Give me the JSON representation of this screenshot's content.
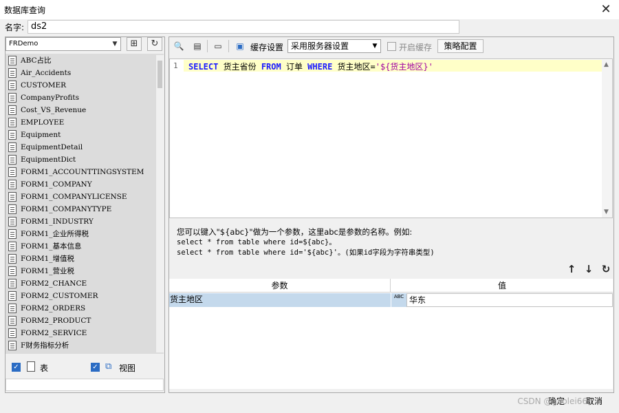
{
  "window": {
    "title": "数据库查询"
  },
  "name": {
    "label": "名字:",
    "value": "ds2"
  },
  "connection": {
    "selected": "FRDemo"
  },
  "tables": [
    "ABC占比",
    "Air_Accidents",
    "CUSTOMER",
    "CompanyProfits",
    "Cost_VS_Revenue",
    "EMPLOYEE",
    "Equipment",
    "EquipmentDetail",
    "EquipmentDict",
    "FORM1_ACCOUNTTINGSYSTEM",
    "FORM1_COMPANY",
    "FORM1_COMPANYLICENSE",
    "FORM1_COMPANYTYPE",
    "FORM1_INDUSTRY",
    "FORM1_企业所得税",
    "FORM1_基本信息",
    "FORM1_增值税",
    "FORM1_营业税",
    "FORM2_CHANCE",
    "FORM2_CUSTOMER",
    "FORM2_ORDERS",
    "FORM2_PRODUCT",
    "FORM2_SERVICE",
    "F财务指标分析"
  ],
  "filters": {
    "table_label": "表",
    "view_label": "视图"
  },
  "toolbar": {
    "cache_settings": "缓存设置",
    "cache_mode": "采用服务器设置",
    "enable_cache": "开启缓存",
    "strategy": "策略配置"
  },
  "editor": {
    "line_number": "1",
    "sql": {
      "kw_select": "SELECT",
      "t1": " 货主省份 ",
      "kw_from": "FROM",
      "t2": " 订单 ",
      "kw_where": "WHERE",
      "t3": " 货主地区=",
      "literal": "'${货主地区}'"
    }
  },
  "hint": {
    "line1": "您可以键入\"${abc}\"做为一个参数，这里abc是参数的名称。例如:",
    "line2": "select * from table where id=${abc}。",
    "line3": "select * from table where id='${abc}'。(如果id字段为字符串类型)"
  },
  "params": {
    "col_name": "参数",
    "col_value": "值",
    "rows": [
      {
        "name": "货主地区",
        "type_icon": "ABC",
        "value": "华东"
      }
    ]
  },
  "footer": {
    "ok": "确定",
    "cancel": "取消",
    "watermark": "CSDN @gaolei66"
  }
}
